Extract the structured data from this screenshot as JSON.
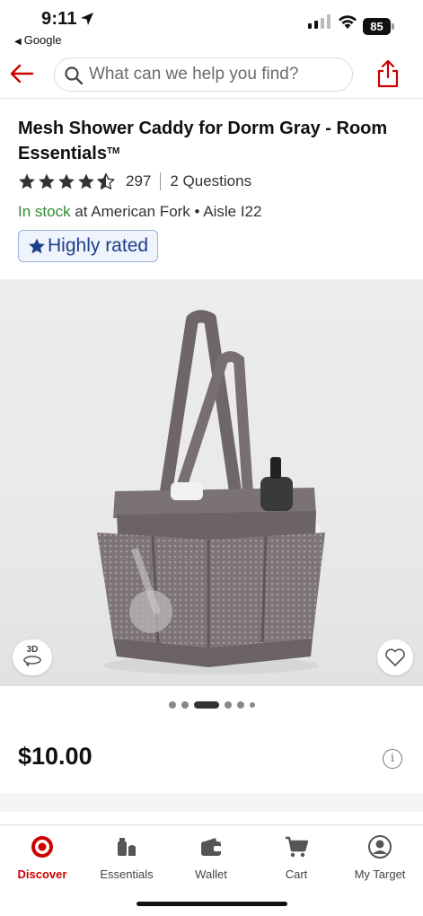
{
  "status_bar": {
    "time": "9:11",
    "back_app": "Google",
    "battery": "85"
  },
  "header": {
    "search_placeholder": "What can we help you find?",
    "brand_color": "#cc0000"
  },
  "product": {
    "title": "Mesh Shower Caddy for Dorm Gray - Room Essentials",
    "trademark": "TM",
    "rating": 4.5,
    "review_count": "297",
    "questions": "2 Questions",
    "stock_status": "In stock",
    "stock_location": " at American Fork • Aisle I22",
    "badge": "Highly rated",
    "price": "$10.00"
  },
  "media": {
    "btn_3d_label": "3D",
    "dot_count": 6,
    "active_dot": 2
  },
  "tabs": [
    {
      "label": "Discover",
      "icon": "target-logo-icon",
      "active": true
    },
    {
      "label": "Essentials",
      "icon": "essentials-icon",
      "active": false
    },
    {
      "label": "Wallet",
      "icon": "wallet-icon",
      "active": false
    },
    {
      "label": "Cart",
      "icon": "cart-icon",
      "active": false
    },
    {
      "label": "My Target",
      "icon": "account-icon",
      "active": false
    }
  ]
}
